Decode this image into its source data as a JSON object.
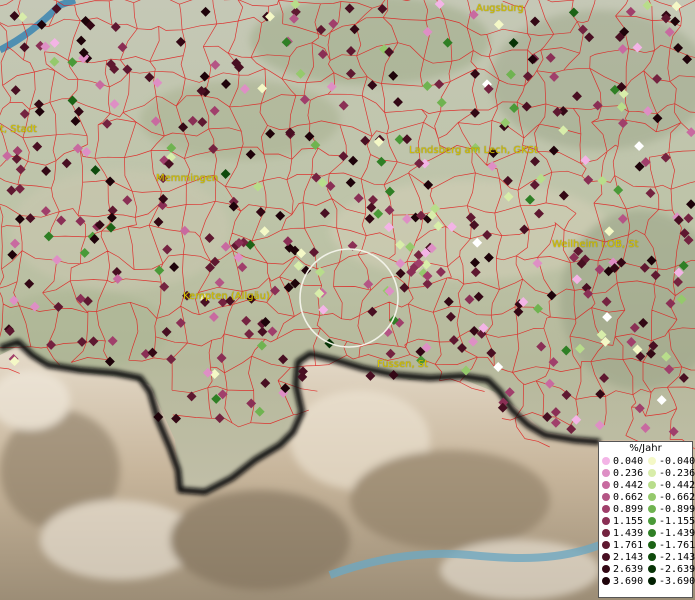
{
  "map": {
    "cities": [
      {
        "id": "augsburg",
        "name": "Augsburg"
      },
      {
        "id": "landsberg",
        "name": "Landsberg am Lech, GKSt"
      },
      {
        "id": "memmingen",
        "name": "Memmingen"
      },
      {
        "id": "kempten",
        "name": "Kempten (Allgäu)"
      },
      {
        "id": "weilheim",
        "name": "Weilheim i.OB, St"
      },
      {
        "id": "fussen",
        "name": "Füssen, St"
      },
      {
        "id": "edge-left",
        "name": "t, Stadt"
      }
    ],
    "legend": {
      "title": "%/Jahr",
      "positive": [
        {
          "label": "0.040",
          "color": "#f3b4e6"
        },
        {
          "label": "0.236",
          "color": "#de8fc5"
        },
        {
          "label": "0.442",
          "color": "#c86aa0"
        },
        {
          "label": "0.662",
          "color": "#b45585"
        },
        {
          "label": "0.899",
          "color": "#a03f6b"
        },
        {
          "label": "1.155",
          "color": "#8a2f55"
        },
        {
          "label": "1.439",
          "color": "#742340"
        },
        {
          "label": "1.761",
          "color": "#5e1830"
        },
        {
          "label": "2.143",
          "color": "#480f22"
        },
        {
          "label": "2.639",
          "color": "#330815"
        },
        {
          "label": "3.690",
          "color": "#1e030a"
        }
      ],
      "negative": [
        {
          "label": "-0.040",
          "color": "#f4f8c6"
        },
        {
          "label": "-0.236",
          "color": "#d8edaa"
        },
        {
          "label": "-0.442",
          "color": "#b8dd8b"
        },
        {
          "label": "-0.662",
          "color": "#95c96c"
        },
        {
          "label": "-0.899",
          "color": "#6fb350"
        },
        {
          "label": "-1.155",
          "color": "#4a9a38"
        },
        {
          "label": "-1.439",
          "color": "#2f7f25"
        },
        {
          "label": "-1.761",
          "color": "#1c6316"
        },
        {
          "label": "-2.143",
          "color": "#0f4a0c"
        },
        {
          "label": "-2.639",
          "color": "#073306"
        },
        {
          "label": "-3.690",
          "color": "#022002"
        }
      ]
    }
  }
}
